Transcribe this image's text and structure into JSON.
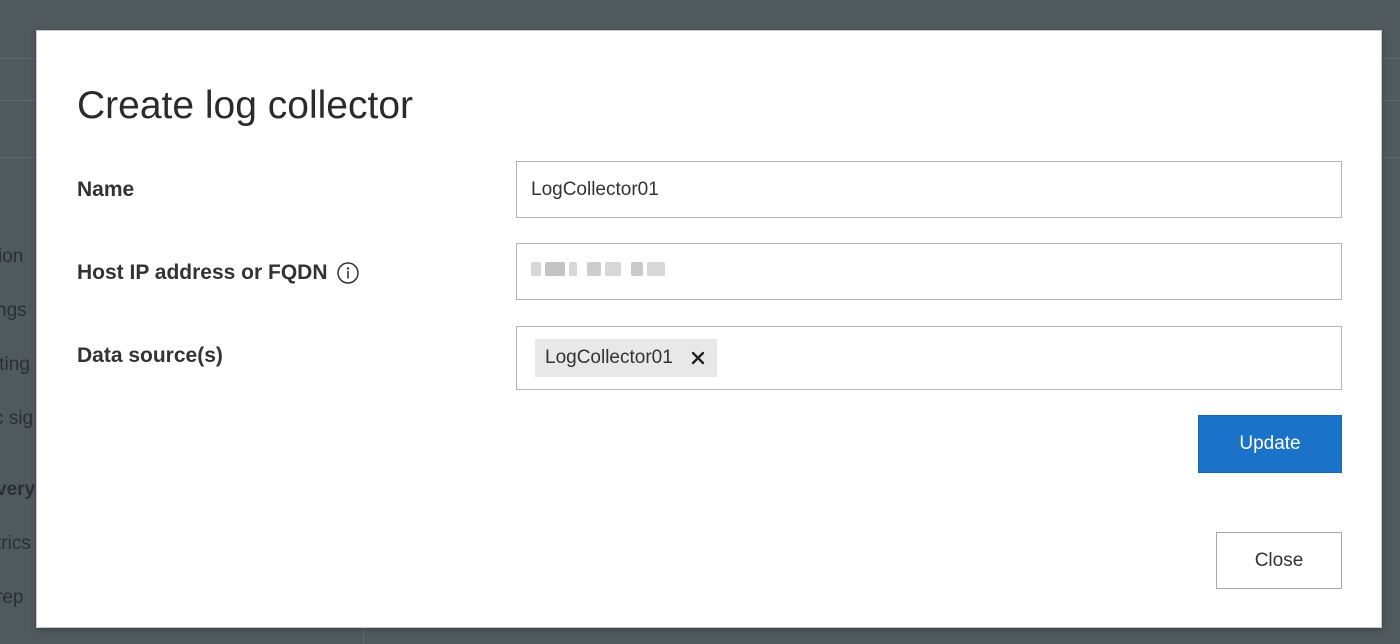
{
  "background": {
    "sidebar_fragments": [
      {
        "text": "ion",
        "bold": false
      },
      {
        "text": "ngs",
        "bold": false
      },
      {
        "text": "tting",
        "bold": false
      },
      {
        "text": "c sig",
        "bold": false
      },
      {
        "text": "very",
        "bold": true
      },
      {
        "text": "trics",
        "bold": false
      },
      {
        "text": "rep",
        "bold": false
      }
    ]
  },
  "dialog": {
    "title": "Create log collector",
    "fields": {
      "name": {
        "label": "Name",
        "value": "LogCollector01"
      },
      "host": {
        "label": "Host IP address or FQDN",
        "info_icon": "info-icon"
      },
      "data_sources": {
        "label": "Data source(s)",
        "tags": [
          "LogCollector01"
        ],
        "tag_remove_icon": "close-icon"
      }
    },
    "update_label": "Update",
    "close_label": "Close"
  },
  "colors": {
    "accent": "#1a73c9",
    "overlay": "#4b5558"
  }
}
